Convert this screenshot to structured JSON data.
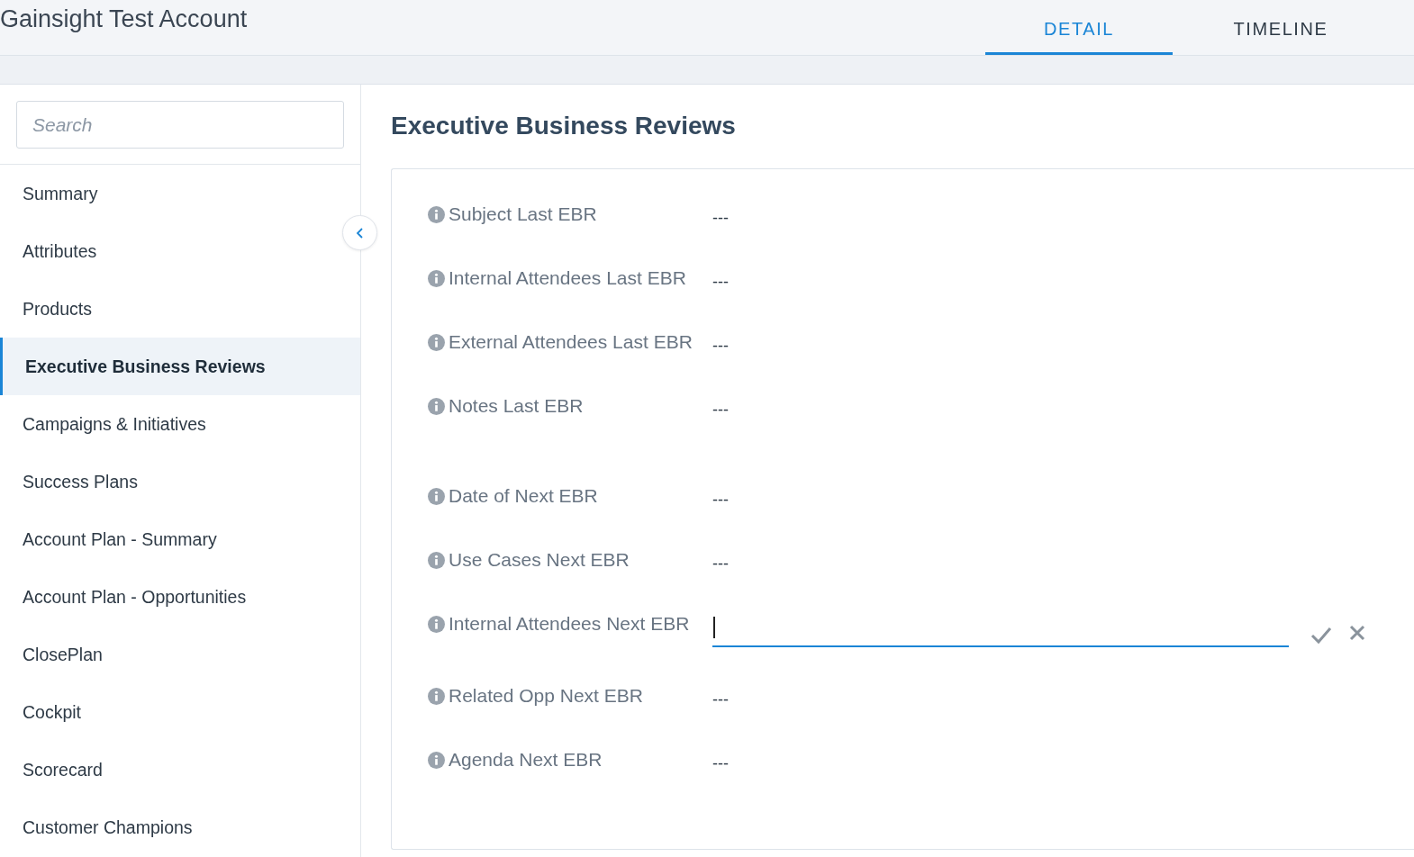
{
  "header": {
    "title": "Gainsight Test Account",
    "tabs": [
      {
        "label": "DETAIL",
        "selected": true
      },
      {
        "label": "TIMELINE",
        "selected": false
      }
    ]
  },
  "sidebar": {
    "search": {
      "placeholder": "Search"
    },
    "items": [
      {
        "label": "Summary",
        "selected": false
      },
      {
        "label": "Attributes",
        "selected": false
      },
      {
        "label": "Products",
        "selected": false
      },
      {
        "label": "Executive Business Reviews",
        "selected": true
      },
      {
        "label": "Campaigns & Initiatives",
        "selected": false
      },
      {
        "label": "Success Plans",
        "selected": false
      },
      {
        "label": "Account Plan - Summary",
        "selected": false
      },
      {
        "label": "Account Plan - Opportunities",
        "selected": false
      },
      {
        "label": "ClosePlan",
        "selected": false
      },
      {
        "label": "Cockpit",
        "selected": false
      },
      {
        "label": "Scorecard",
        "selected": false
      },
      {
        "label": "Customer Champions",
        "selected": false
      }
    ]
  },
  "section": {
    "title": "Executive Business Reviews",
    "fields": [
      {
        "kind": "text",
        "label": "Subject Last EBR",
        "value": "---"
      },
      {
        "kind": "text",
        "label": "Internal Attendees Last EBR",
        "value": "---"
      },
      {
        "kind": "text",
        "label": "External Attendees Last EBR",
        "value": "---"
      },
      {
        "kind": "longtext",
        "label": "Notes Last EBR",
        "value": "---"
      },
      {
        "kind": "text",
        "label": "Date of Next EBR",
        "value": "---"
      },
      {
        "kind": "text",
        "label": "Use Cases Next EBR",
        "value": "---"
      },
      {
        "kind": "editing",
        "label": "Internal Attendees Next EBR"
      },
      {
        "kind": "text",
        "label": "Related Opp Next EBR",
        "value": "---"
      },
      {
        "kind": "longtext",
        "label": "Agenda Next EBR",
        "value": "---"
      }
    ]
  }
}
